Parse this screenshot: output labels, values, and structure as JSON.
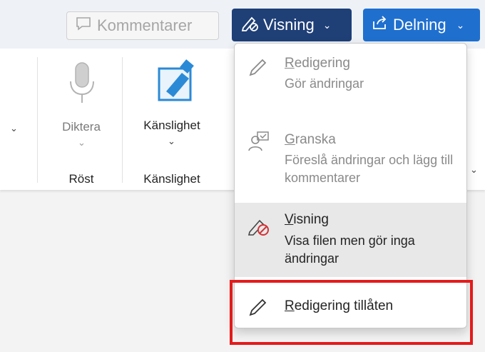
{
  "toolbar": {
    "comments_label": "Kommentarer",
    "view_label": "Visning",
    "share_label": "Delning"
  },
  "ribbon": {
    "dictate_label": "Diktera",
    "voice_group_label": "Röst",
    "sensitivity_button_label": "Känslighet",
    "sensitivity_group_label": "Känslighet"
  },
  "menu": {
    "items": [
      {
        "title_accel": "R",
        "title_rest": "edigering",
        "description": "Gör ändringar"
      },
      {
        "title_accel": "G",
        "title_rest": "ranska",
        "description": "Föreslå ändringar och lägg till kommentarer"
      },
      {
        "title_accel": "V",
        "title_rest": "isning",
        "description": "Visa filen men gör inga ändringar"
      },
      {
        "title_accel": "R",
        "title_rest": "edigering tillåten"
      }
    ]
  },
  "colors": {
    "view_button": "#1f3f77",
    "share_button": "#1f6fcf",
    "highlight": "#e41b1b"
  }
}
